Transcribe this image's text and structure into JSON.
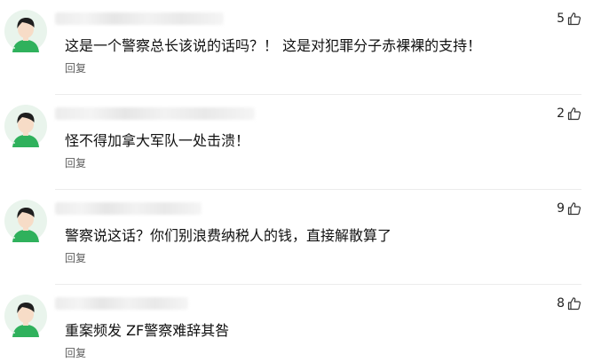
{
  "comments": [
    {
      "text": "这是一个警察总长该说的话吗？！ 这是对犯罪分子赤裸裸的支持！",
      "likes": "5",
      "reply_label": "回复"
    },
    {
      "text": "怪不得加拿大军队一处击溃！",
      "likes": "2",
      "reply_label": "回复"
    },
    {
      "text": "警察说这话？你们别浪费纳税人的钱，直接解散算了",
      "likes": "9",
      "reply_label": "回复"
    },
    {
      "text": "重案频发 ZF警察难辞其咎",
      "likes": "8",
      "reply_label": "回复"
    }
  ],
  "icons": {
    "avatar": "person-avatar-icon",
    "like": "thumbs-up-icon"
  },
  "colors": {
    "avatar_bg": "#e9f4ec",
    "avatar_shirt": "#2fb15c",
    "avatar_hair": "#1f1f1f",
    "avatar_skin": "#f7dcc7"
  }
}
